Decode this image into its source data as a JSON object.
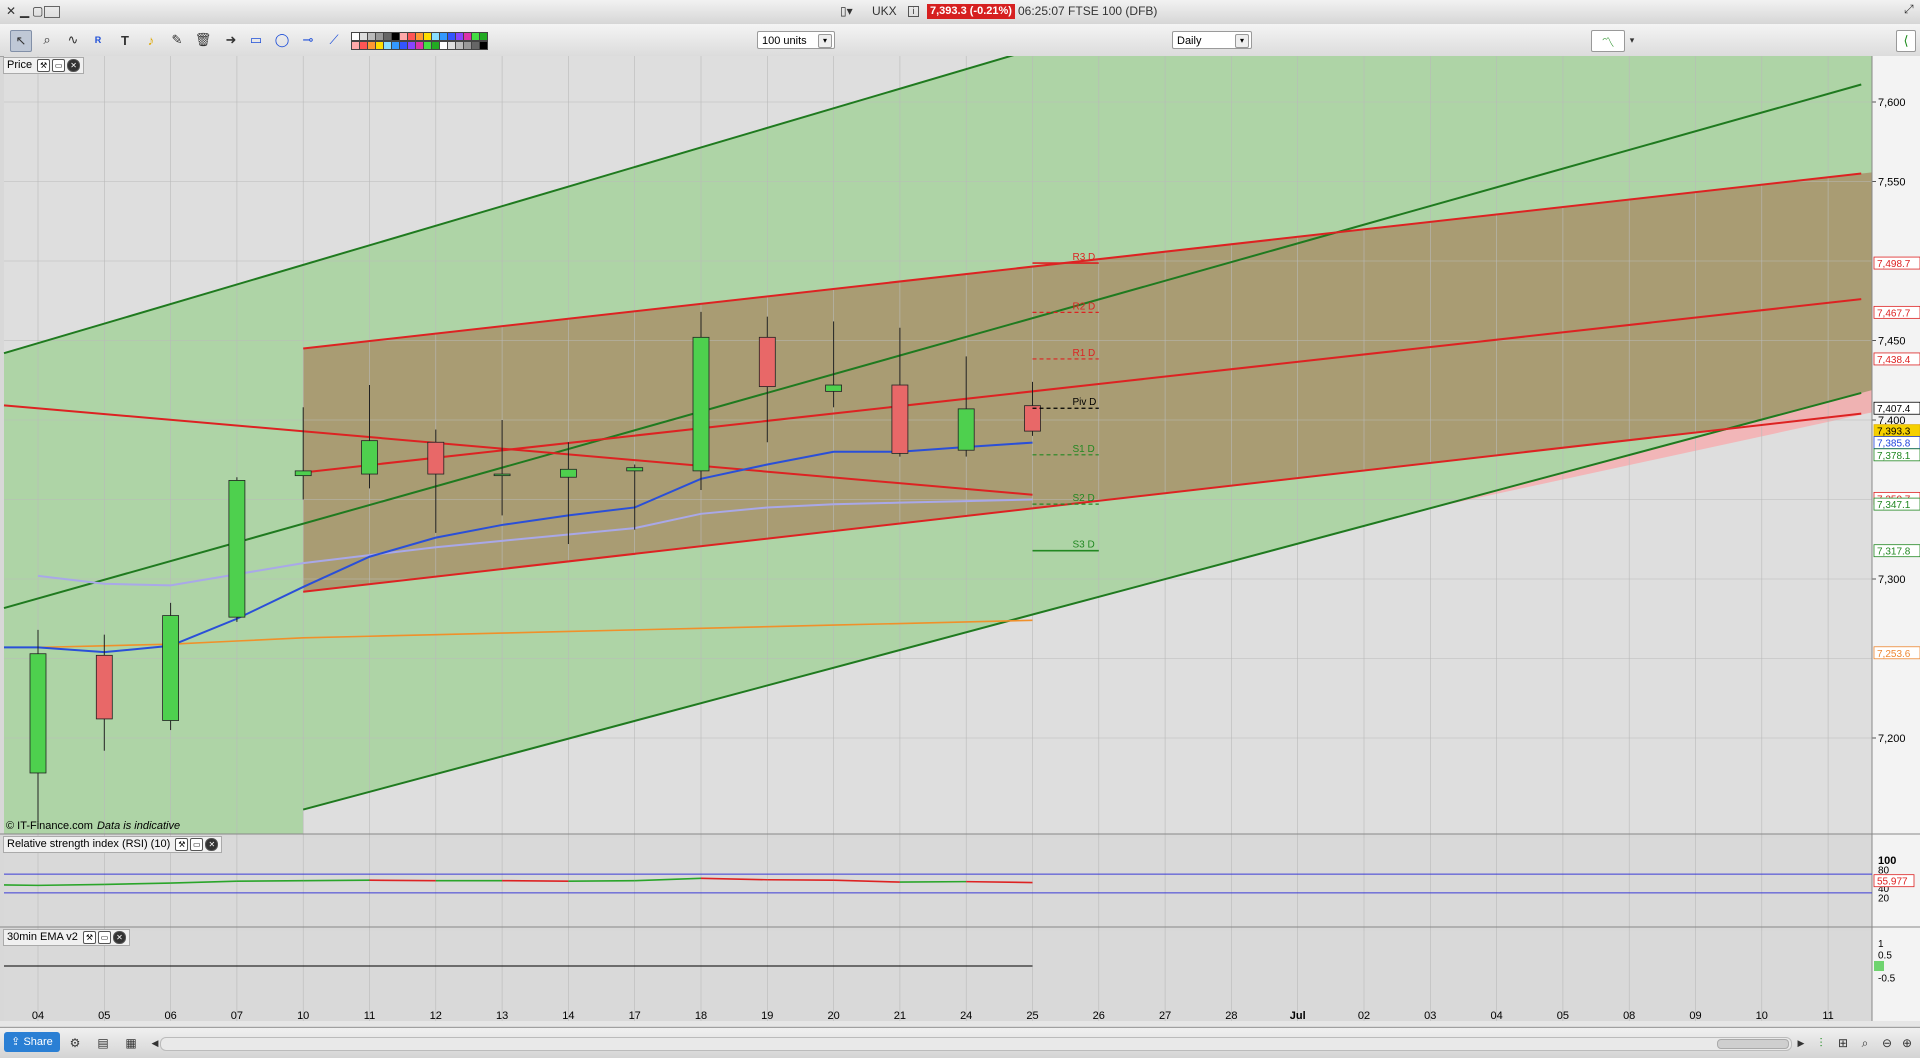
{
  "window": {
    "symbol": "UKX",
    "price_badge": "7,393.3 (-0.21%)",
    "title_rest": "06:25:07 FTSE 100 (DFB)"
  },
  "toolbar": {
    "units_select": "100 units",
    "period_select": "Daily"
  },
  "panels": {
    "price_label": "Price",
    "rsi_label": "Relative strength index (RSI) (10)",
    "ema_label": "30min EMA v2",
    "copyright": "© IT-Finance.com",
    "indicative": "Data is indicative"
  },
  "price_axis": {
    "ticks": [
      "7,600",
      "7,550",
      "7,450",
      "7,400",
      "7,300",
      "7,200"
    ],
    "tick_values": [
      7600,
      7550,
      7450,
      7400,
      7300,
      7200
    ]
  },
  "price_tags": [
    {
      "label": "7,498.7",
      "value": 7498.7,
      "color": "#dd2222",
      "text": "#dd2222",
      "bg": "#fff"
    },
    {
      "label": "7,467.7",
      "value": 7467.7,
      "color": "#dd2222",
      "text": "#dd2222",
      "bg": "#fff"
    },
    {
      "label": "7,438.4",
      "value": 7438.4,
      "color": "#dd2222",
      "text": "#dd2222",
      "bg": "#fff"
    },
    {
      "label": "7,407.4",
      "value": 7407.4,
      "color": "#000000",
      "text": "#000000",
      "bg": "#fff"
    },
    {
      "label": "7,393.3",
      "value": 7393.3,
      "color": "#e0b000",
      "text": "#000000",
      "bg": "#f5d000"
    },
    {
      "label": "7,385.8",
      "value": 7385.8,
      "color": "#2244dd",
      "text": "#2244dd",
      "bg": "#fff"
    },
    {
      "label": "7,378.1",
      "value": 7378.1,
      "color": "#228822",
      "text": "#228822",
      "bg": "#fff"
    },
    {
      "label": "7,350.7",
      "value": 7350.7,
      "color": "#dd2222",
      "text": "#dd2222",
      "bg": "#fff"
    },
    {
      "label": "7,347.1",
      "value": 7347.1,
      "color": "#228822",
      "text": "#228822",
      "bg": "#fff"
    },
    {
      "label": "7,317.8",
      "value": 7317.8,
      "color": "#228822",
      "text": "#228822",
      "bg": "#fff"
    },
    {
      "label": "7,253.6",
      "value": 7253.6,
      "color": "#ee8833",
      "text": "#ee8833",
      "bg": "#fff"
    }
  ],
  "pivots": [
    {
      "label": "R3 D",
      "value": 7498.7,
      "color": "#dd2222",
      "dashed": false
    },
    {
      "label": "R2 D",
      "value": 7467.7,
      "color": "#dd2222",
      "dashed": true
    },
    {
      "label": "R1 D",
      "value": 7438.4,
      "color": "#dd2222",
      "dashed": true
    },
    {
      "label": "Piv D",
      "value": 7407.4,
      "color": "#000000",
      "dashed": true
    },
    {
      "label": "S1 D",
      "value": 7378.1,
      "color": "#228822",
      "dashed": true
    },
    {
      "label": "S2 D",
      "value": 7347.1,
      "color": "#228822",
      "dashed": true
    },
    {
      "label": "S3 D",
      "value": 7317.8,
      "color": "#228822",
      "dashed": false
    }
  ],
  "rsi_axis": {
    "ticks": [
      "100",
      "80",
      "60",
      "40",
      "20"
    ],
    "tick_values": [
      100,
      80,
      60,
      40,
      20
    ],
    "current_label": "55.977",
    "current_value": 55.977
  },
  "ema_axis": {
    "ticks": [
      "1",
      "0.5",
      "0",
      "-0.5"
    ],
    "tick_values": [
      1,
      0.5,
      0,
      -0.5
    ]
  },
  "date_axis": [
    "04",
    "05",
    "06",
    "07",
    "10",
    "11",
    "12",
    "13",
    "14",
    "17",
    "18",
    "19",
    "20",
    "21",
    "24",
    "25",
    "26",
    "27",
    "28",
    "Jul",
    "02",
    "03",
    "04",
    "05",
    "08",
    "09",
    "10",
    "11"
  ],
  "chart_data": {
    "type": "candlestick",
    "instrument": "FTSE 100 (DFB)",
    "interval": "Daily",
    "categories": [
      "04",
      "05",
      "06",
      "07",
      "10",
      "11",
      "12",
      "13",
      "14",
      "17",
      "18",
      "19",
      "20",
      "21",
      "24",
      "25"
    ],
    "ohlc": [
      {
        "o": 7178,
        "h": 7268,
        "l": 7145,
        "c": 7253
      },
      {
        "o": 7252,
        "h": 7265,
        "l": 7192,
        "c": 7212
      },
      {
        "o": 7211,
        "h": 7285,
        "l": 7205,
        "c": 7277
      },
      {
        "o": 7276,
        "h": 7364,
        "l": 7273,
        "c": 7362
      },
      {
        "o": 7365,
        "h": 7408,
        "l": 7350,
        "c": 7368
      },
      {
        "o": 7366,
        "h": 7422,
        "l": 7357,
        "c": 7387
      },
      {
        "o": 7386,
        "h": 7394,
        "l": 7329,
        "c": 7366
      },
      {
        "o": 7365,
        "h": 7400,
        "l": 7340,
        "c": 7366
      },
      {
        "o": 7364,
        "h": 7386,
        "l": 7322,
        "c": 7369
      },
      {
        "o": 7368,
        "h": 7372,
        "l": 7331,
        "c": 7370
      },
      {
        "o": 7368,
        "h": 7468,
        "l": 7356,
        "c": 7452
      },
      {
        "o": 7452,
        "h": 7465,
        "l": 7386,
        "c": 7421
      },
      {
        "o": 7418,
        "h": 7462,
        "l": 7408,
        "c": 7422
      },
      {
        "o": 7422,
        "h": 7458,
        "l": 7377,
        "c": 7379
      },
      {
        "o": 7381,
        "h": 7440,
        "l": 7377,
        "c": 7407
      },
      {
        "o": 7409,
        "h": 7424,
        "l": 7390,
        "c": 7393
      }
    ],
    "ma_blue": [
      7257,
      7254,
      7258,
      7275,
      7295,
      7314,
      7326,
      7334,
      7340,
      7345,
      7363,
      7372,
      7380,
      7380,
      7383,
      7385.8
    ],
    "ma_lavender": [
      7302,
      7297,
      7296,
      7303,
      7310,
      7315,
      7320,
      7324,
      7328,
      7332,
      7341,
      7345,
      7347,
      7348,
      7349,
      7350
    ],
    "ma_orange": [
      7257,
      7258,
      7259,
      7261,
      7263,
      7264,
      7265,
      7266,
      7267,
      7268,
      7269,
      7270,
      7271,
      7272,
      7273,
      7274
    ],
    "rsi_values": [
      46,
      48,
      51,
      55,
      56,
      57,
      56,
      56,
      55,
      56,
      61,
      58,
      57,
      53,
      54,
      52
    ],
    "ema_values": [
      0,
      0,
      0,
      0,
      0,
      0,
      0,
      0,
      0,
      0,
      0,
      0,
      0,
      0,
      0,
      0
    ],
    "trendlines": [
      {
        "color": "#1f7a1f",
        "x1": -1,
        "y1": 7436,
        "x2": 15,
        "y2": 7633
      },
      {
        "color": "#1f7a1f",
        "x1": -1,
        "y1": 7276,
        "x2": 27.5,
        "y2": 7611
      },
      {
        "color": "#1f7a1f",
        "x1": 4,
        "y1": 7155,
        "x2": 27.5,
        "y2": 7417
      },
      {
        "color": "#dd2222",
        "x1": 4,
        "y1": 7445,
        "x2": 27.5,
        "y2": 7555
      },
      {
        "color": "#dd2222",
        "x1": 4,
        "y1": 7367,
        "x2": 27.5,
        "y2": 7476
      },
      {
        "color": "#dd2222",
        "x1": 4,
        "y1": 7292,
        "x2": 27.5,
        "y2": 7404
      },
      {
        "color": "#dd2222",
        "x1": -1,
        "y1": 7411,
        "x2": 15,
        "y2": 7353
      }
    ],
    "ylim": [
      7160,
      7645
    ]
  }
}
